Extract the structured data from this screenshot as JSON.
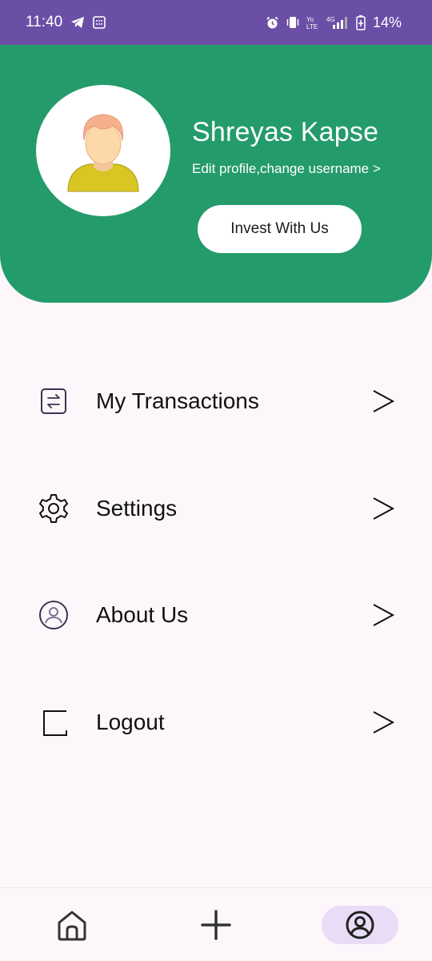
{
  "status_bar": {
    "time": "11:40",
    "network": "4G",
    "battery": "14%"
  },
  "profile": {
    "name": "Shreyas Kapse",
    "edit_link": "Edit profile,change username >",
    "invest_button": "Invest With Us"
  },
  "menu": [
    {
      "label": "My Transactions",
      "icon": "transactions-icon"
    },
    {
      "label": "Settings",
      "icon": "gear-icon"
    },
    {
      "label": "About Us",
      "icon": "user-circle-icon"
    },
    {
      "label": "Logout",
      "icon": "logout-icon"
    }
  ],
  "bottom_nav": {
    "items": [
      "home-icon",
      "plus-icon",
      "profile-icon"
    ],
    "active": "profile-icon"
  },
  "colors": {
    "status_bar": "#6b4fa6",
    "header": "#249b6b",
    "background": "#fdf7fb",
    "active_pill": "#e8dcf7"
  }
}
